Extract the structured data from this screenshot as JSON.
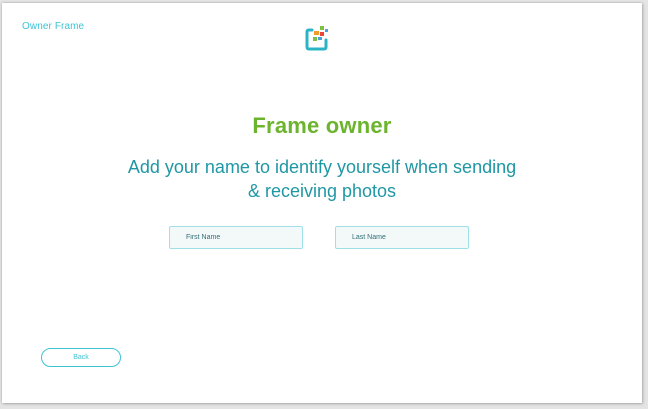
{
  "window": {
    "label": "Owner Frame"
  },
  "logo": {
    "icon": "app-logo-icon",
    "colors": {
      "frame": "#2bb3c6",
      "tile_orange": "#f39c2c",
      "tile_green": "#7cc144",
      "tile_red": "#e8473f",
      "tile_blue": "#4da3d9"
    }
  },
  "main": {
    "title": "Frame owner",
    "subtitle": "Add your name to identify yourself when sending & receiving photos"
  },
  "form": {
    "first_name": {
      "value": "",
      "placeholder": "First Name"
    },
    "last_name": {
      "value": "",
      "placeholder": "Last Name"
    }
  },
  "footer": {
    "back_label": "Back"
  },
  "colors": {
    "accent": "#3ec3d5",
    "title_green": "#6cb42d",
    "subtitle_teal": "#1f97a4"
  }
}
